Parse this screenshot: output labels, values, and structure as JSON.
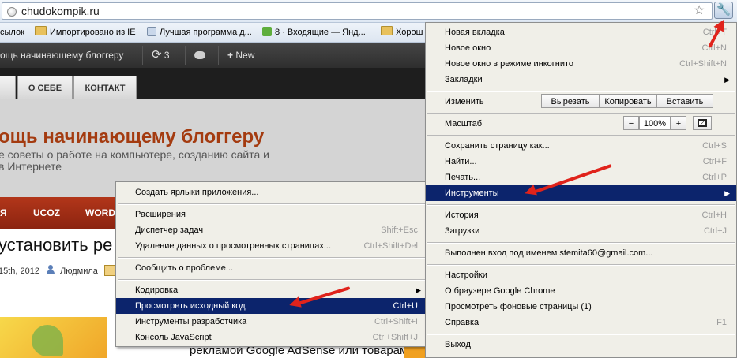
{
  "browser": {
    "url": "chudokompik.ru",
    "bookmarks": [
      "сылок",
      "Импортировано из IE",
      "Лучшая программа д...",
      "8 · Входящие — Янд...",
      "Хорош"
    ]
  },
  "admin_bar": {
    "site_name": "ощь начинающему блоггеру",
    "updates_count": "3",
    "new_label": "New"
  },
  "site": {
    "nav_tabs": [
      "О СЕБЕ",
      "КОНТАКТ"
    ],
    "title": "ощь начинающему блоггеру",
    "description_line1": "е советы о работе на компьютере, созданию сайта и",
    "description_line2": "в Интернете",
    "categories": [
      "Я",
      "UCOZ",
      "WORD"
    ],
    "post_title": "установить ре",
    "post_date": "15th, 2012",
    "post_author": "Людмила",
    "post_snippet": "рекламой Google AdSense или товарами для"
  },
  "chrome_menu": {
    "items": [
      {
        "label": "Новая вкладка",
        "shortcut": "Ctrl+T"
      },
      {
        "label": "Новое окно",
        "shortcut": "Ctrl+N"
      },
      {
        "label": "Новое окно в режиме инкогнито",
        "shortcut": "Ctrl+Shift+N"
      },
      {
        "label": "Закладки",
        "shortcut": ""
      },
      {
        "label": "Изменить",
        "shortcut": ""
      },
      {
        "label": "Масштаб",
        "shortcut": ""
      },
      {
        "label": "Сохранить страницу как...",
        "shortcut": "Ctrl+S"
      },
      {
        "label": "Найти...",
        "shortcut": "Ctrl+F"
      },
      {
        "label": "Печать...",
        "shortcut": "Ctrl+P"
      },
      {
        "label": "Инструменты",
        "shortcut": ""
      },
      {
        "label": "История",
        "shortcut": "Ctrl+H"
      },
      {
        "label": "Загрузки",
        "shortcut": "Ctrl+J"
      },
      {
        "label": "Выполнен вход под именем stemita60@gmail.com...",
        "shortcut": ""
      },
      {
        "label": "Настройки",
        "shortcut": ""
      },
      {
        "label": "О браузере Google Chrome",
        "shortcut": ""
      },
      {
        "label": "Просмотреть фоновые страницы (1)",
        "shortcut": ""
      },
      {
        "label": "Справка",
        "shortcut": "F1"
      },
      {
        "label": "Выход",
        "shortcut": ""
      }
    ],
    "edit_buttons": {
      "cut": "Вырезать",
      "copy": "Копировать",
      "paste": "Вставить"
    },
    "zoom": {
      "minus": "−",
      "value": "100%",
      "plus": "+"
    }
  },
  "tools_submenu": {
    "items": [
      {
        "label": "Создать ярлыки приложения...",
        "shortcut": ""
      },
      {
        "label": "Расширения",
        "shortcut": ""
      },
      {
        "label": "Диспетчер задач",
        "shortcut": "Shift+Esc"
      },
      {
        "label": "Удаление данных о просмотренных страницах...",
        "shortcut": "Ctrl+Shift+Del"
      },
      {
        "label": "Сообщить о проблеме...",
        "shortcut": ""
      },
      {
        "label": "Кодировка",
        "shortcut": ""
      },
      {
        "label": "Просмотреть исходный код",
        "shortcut": "Ctrl+U"
      },
      {
        "label": "Инструменты разработчика",
        "shortcut": "Ctrl+Shift+I"
      },
      {
        "label": "Консоль JavaScript",
        "shortcut": "Ctrl+Shift+J"
      }
    ]
  },
  "colors": {
    "menu_highlight": "#0c246c",
    "annotation_arrow": "#e0231b",
    "site_title": "#a43b10",
    "category_bar": "#a02c15"
  }
}
